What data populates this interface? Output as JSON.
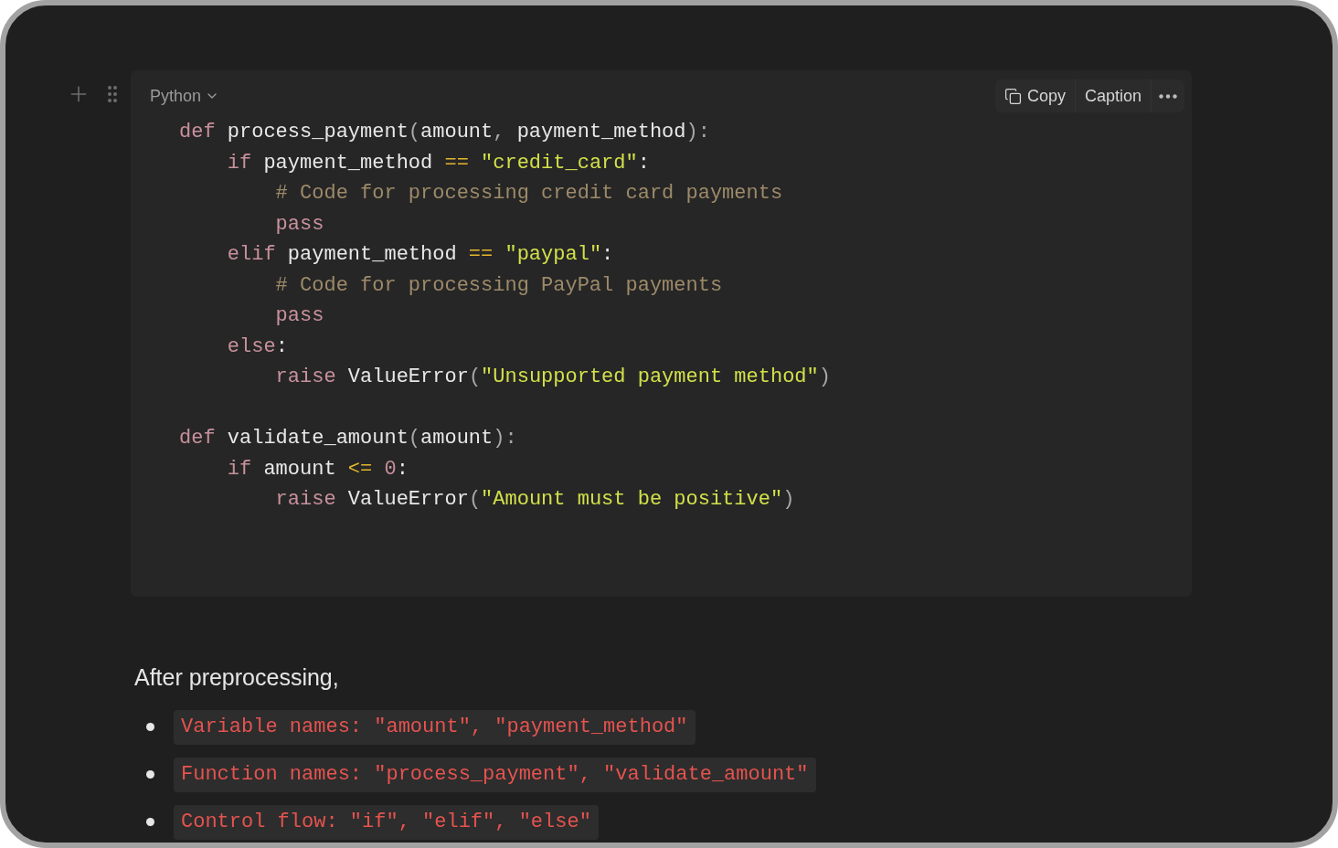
{
  "code_block": {
    "language": "Python",
    "actions": [
      {
        "kind": "copy",
        "label": "Copy"
      },
      {
        "kind": "caption",
        "label": "Caption"
      },
      {
        "kind": "more"
      }
    ],
    "lines": [
      {
        "tokens": [
          {
            "kind": "keyword",
            "text": "def"
          },
          {
            "kind": "plain",
            "text": " process_payment"
          },
          {
            "kind": "punct",
            "text": "("
          },
          {
            "kind": "plain",
            "text": "amount"
          },
          {
            "kind": "punct",
            "text": ", "
          },
          {
            "kind": "plain",
            "text": "payment_method"
          },
          {
            "kind": "punct",
            "text": "):"
          }
        ]
      },
      {
        "tokens": [
          {
            "kind": "keyword",
            "text": "    if"
          },
          {
            "kind": "plain",
            "text": " payment_method "
          },
          {
            "kind": "operator",
            "text": "== "
          },
          {
            "kind": "string",
            "text": "\"credit_card\""
          },
          {
            "kind": "plain",
            "text": ":"
          }
        ]
      },
      {
        "tokens": [
          {
            "kind": "comment",
            "text": "        # Code for processing credit card payments"
          }
        ]
      },
      {
        "tokens": [
          {
            "kind": "keyword",
            "text": "        pass"
          }
        ]
      },
      {
        "tokens": [
          {
            "kind": "keyword",
            "text": "    elif"
          },
          {
            "kind": "plain",
            "text": " payment_method "
          },
          {
            "kind": "operator",
            "text": "== "
          },
          {
            "kind": "string",
            "text": "\"paypal\""
          },
          {
            "kind": "plain",
            "text": ":"
          }
        ]
      },
      {
        "tokens": [
          {
            "kind": "comment",
            "text": "        # Code for processing PayPal payments"
          }
        ]
      },
      {
        "tokens": [
          {
            "kind": "keyword",
            "text": "        pass"
          }
        ]
      },
      {
        "tokens": [
          {
            "kind": "keyword",
            "text": "    else"
          },
          {
            "kind": "plain",
            "text": ":"
          }
        ]
      },
      {
        "tokens": [
          {
            "kind": "keyword",
            "text": "        raise"
          },
          {
            "kind": "plain",
            "text": " ValueError"
          },
          {
            "kind": "punct",
            "text": "("
          },
          {
            "kind": "string",
            "text": "\"Unsupported payment method\""
          },
          {
            "kind": "punct",
            "text": ")"
          }
        ]
      },
      {
        "blank_before": true,
        "tokens": [
          {
            "kind": "keyword",
            "text": "def"
          },
          {
            "kind": "plain",
            "text": " validate_amount"
          },
          {
            "kind": "punct",
            "text": "("
          },
          {
            "kind": "plain",
            "text": "amount"
          },
          {
            "kind": "punct",
            "text": "):"
          }
        ]
      },
      {
        "tokens": [
          {
            "kind": "keyword",
            "text": "    if"
          },
          {
            "kind": "plain",
            "text": " amount "
          },
          {
            "kind": "operator",
            "text": "<= "
          },
          {
            "kind": "number",
            "text": "0"
          },
          {
            "kind": "plain",
            "text": ":"
          }
        ]
      },
      {
        "tokens": [
          {
            "kind": "keyword",
            "text": "        raise"
          },
          {
            "kind": "plain",
            "text": " ValueError"
          },
          {
            "kind": "punct",
            "text": "("
          },
          {
            "kind": "string",
            "text": "\"Amount must be positive\""
          },
          {
            "kind": "punct",
            "text": ")"
          }
        ]
      }
    ]
  },
  "paragraph": "After preprocessing,",
  "bullets": [
    "Variable names: \"amount\", \"payment_method\"",
    "Function names: \"process_payment\", \"validate_amount\"",
    "Control flow: \"if\", \"elif\", \"else\""
  ]
}
